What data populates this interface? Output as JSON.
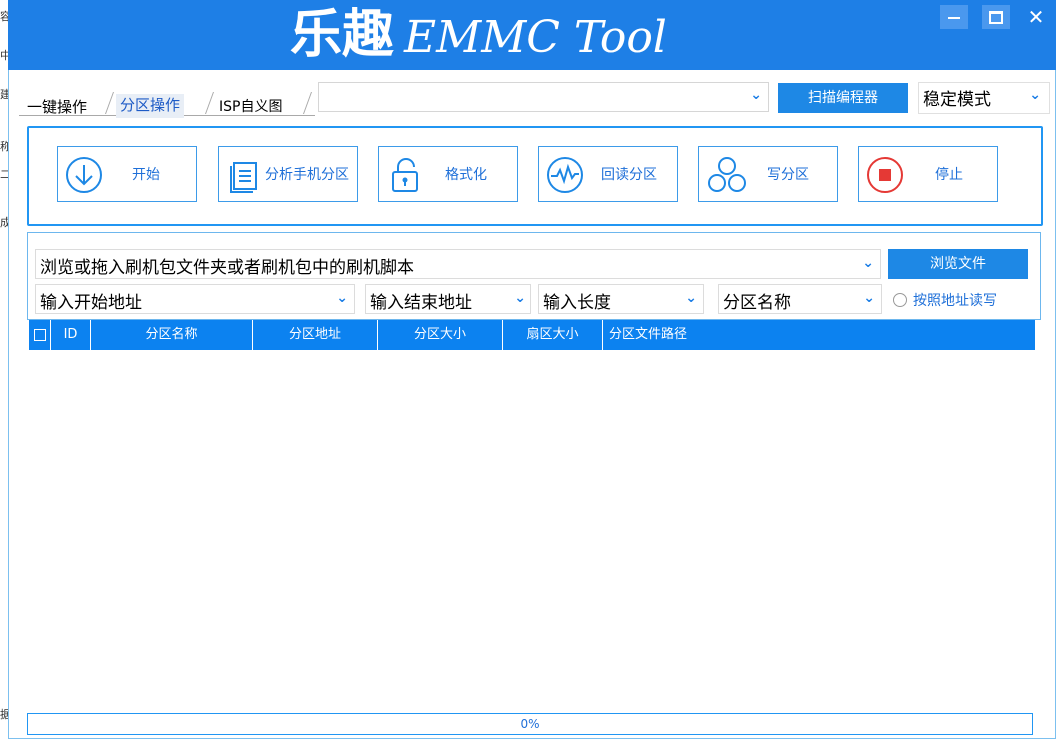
{
  "background_window": {
    "chars": [
      "容",
      "中",
      "建",
      "称",
      "二",
      "成",
      "据"
    ]
  },
  "titlebar": {
    "title_cn": "乐趣",
    "title_en": "EMMC Tool",
    "minimize": "—",
    "maximize": "□",
    "close": "✕"
  },
  "tabs": [
    {
      "label": "一键操作",
      "active": false
    },
    {
      "label": "分区操作",
      "active": true
    },
    {
      "label": "ISP自义图",
      "active": false
    }
  ],
  "top": {
    "programmer_combo_value": "",
    "scan_button": "扫描编程器",
    "mode_value": "稳定模式"
  },
  "toolbar": {
    "buttons": [
      {
        "label": "开始",
        "icon": "download-circle-icon"
      },
      {
        "label": "分析手机分区",
        "icon": "document-icon"
      },
      {
        "label": "格式化",
        "icon": "unlock-icon"
      },
      {
        "label": "回读分区",
        "icon": "waveform-icon"
      },
      {
        "label": "写分区",
        "icon": "circles-icon"
      },
      {
        "label": "停止",
        "icon": "stop-circle-icon"
      }
    ]
  },
  "file": {
    "path_placeholder": "浏览或拖入刷机包文件夹或者刷机包中的刷机脚本",
    "browse_button": "浏览文件",
    "start_address": "输入开始地址",
    "end_address": "输入结束地址",
    "length": "输入长度",
    "partition_name": "分区名称",
    "radio_label": "按照地址读写"
  },
  "table": {
    "columns": [
      "ID",
      "分区名称",
      "分区地址",
      "分区大小",
      "扇区大小",
      "分区文件路径"
    ],
    "rows": []
  },
  "progress": {
    "value": 0,
    "label": "0%"
  },
  "colors": {
    "accent": "#1e88e5",
    "titlebar": "#1e7fe6",
    "header": "#0c82f0",
    "stop": "#e53935"
  }
}
